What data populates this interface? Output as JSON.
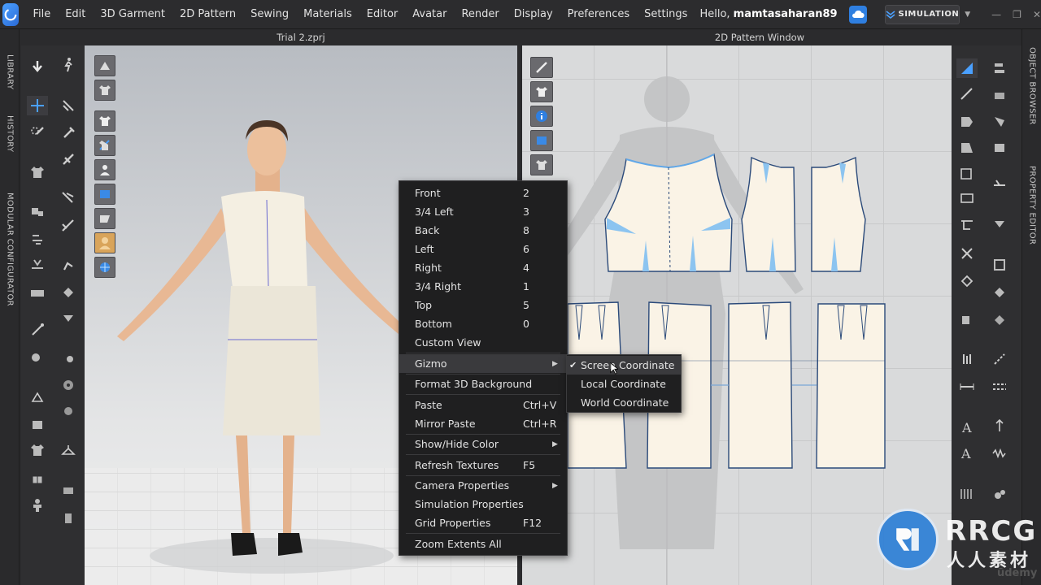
{
  "menubar": {
    "items": [
      "File",
      "Edit",
      "3D Garment",
      "2D Pattern",
      "Sewing",
      "Materials",
      "Editor",
      "Avatar",
      "Render",
      "Display",
      "Preferences",
      "Settings"
    ],
    "greeting_prefix": "Hello, ",
    "username": "mamtasaharan89",
    "simulation_label": "SIMULATION"
  },
  "left_tabs": [
    "LIBRARY",
    "HISTORY",
    "MODULAR CONFIGURATOR"
  ],
  "right_tabs": [
    "OBJECT BROWSER",
    "PROPERTY EDITOR"
  ],
  "panels": {
    "viewport_3d_title": "Trial 2.zprj",
    "pattern_window_title": "2D Pattern Window"
  },
  "context_menu": {
    "items": [
      {
        "label": "Front",
        "shortcut": "2"
      },
      {
        "label": "3/4 Left",
        "shortcut": "3"
      },
      {
        "label": "Back",
        "shortcut": "8"
      },
      {
        "label": "Left",
        "shortcut": "6"
      },
      {
        "label": "Right",
        "shortcut": "4"
      },
      {
        "label": "3/4 Right",
        "shortcut": "1"
      },
      {
        "label": "Top",
        "shortcut": "5"
      },
      {
        "label": "Bottom",
        "shortcut": "0"
      },
      {
        "label": "Custom View",
        "shortcut": ""
      },
      {
        "label": "Gizmo",
        "shortcut": "",
        "submenu": true
      },
      {
        "label": "Format 3D Background",
        "shortcut": ""
      },
      {
        "label": "Paste",
        "shortcut": "Ctrl+V"
      },
      {
        "label": "Mirror Paste",
        "shortcut": "Ctrl+R"
      },
      {
        "label": "Show/Hide Color",
        "shortcut": "",
        "submenu": true
      },
      {
        "label": "Refresh Textures",
        "shortcut": "F5"
      },
      {
        "label": "Camera Properties",
        "shortcut": "",
        "submenu": true
      },
      {
        "label": "Simulation Properties",
        "shortcut": ""
      },
      {
        "label": "Grid Properties",
        "shortcut": "F12"
      },
      {
        "label": "Zoom Extents All",
        "shortcut": ""
      }
    ]
  },
  "gizmo_submenu": {
    "items": [
      {
        "label": "Screen Coordinate",
        "checked": true
      },
      {
        "label": "Local Coordinate",
        "checked": false
      },
      {
        "label": "World Coordinate",
        "checked": false
      }
    ]
  },
  "watermark": {
    "brand": "RRCG",
    "sub": "人人素材",
    "udemy": "ūdemy"
  },
  "colors": {
    "accent": "#2f7fe0",
    "menu_bg": "#1f1f20",
    "viewport_bg": "#d9dadb",
    "fabric": "#faf3e6",
    "pattern_outline": "#2b4a7a"
  }
}
